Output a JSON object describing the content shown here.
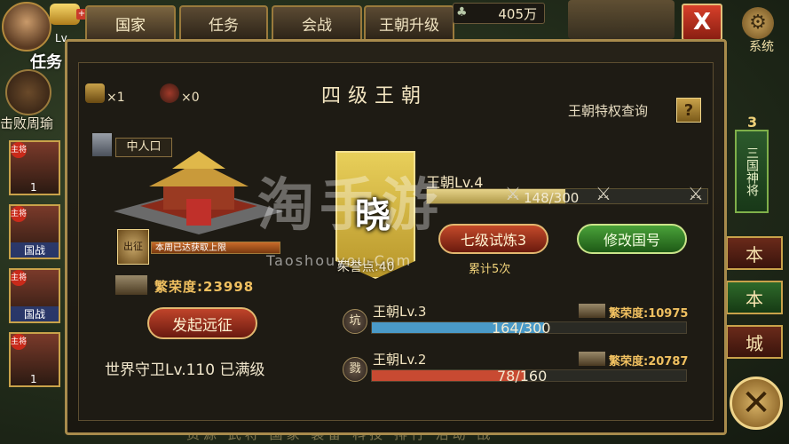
{
  "tabs": [
    {
      "label": "国家",
      "active": true
    },
    {
      "label": "任务",
      "active": false
    },
    {
      "label": "会战",
      "active": false
    },
    {
      "label": "王朝升级",
      "active": false
    }
  ],
  "top_bar": {
    "silver_amount": "405万",
    "close_label": "X",
    "system_label": "系统",
    "avatar_level_label": "Lv"
  },
  "left_strip": {
    "task_label": "任务",
    "defeat_text": "击败周瑜",
    "heroes": [
      {
        "badge": "主将",
        "foot": "1",
        "foot_style": "plain"
      },
      {
        "badge": "主将",
        "foot": "国战",
        "foot_style": "banner"
      },
      {
        "badge": "主将",
        "foot": "国战",
        "foot_style": "banner"
      },
      {
        "badge": "主将",
        "foot": "1",
        "foot_style": "plain"
      }
    ]
  },
  "right_strip": {
    "number": "3",
    "banner": "三国神将",
    "buttons": [
      "本",
      "本",
      "城"
    ]
  },
  "panel": {
    "title": "四级王朝",
    "privilege_link": "王朝特权查询",
    "help_label": "?",
    "resources": [
      {
        "icon": "seal-icon",
        "count": "×1"
      },
      {
        "icon": "gourd-icon",
        "count": "×0"
      }
    ],
    "population": "中人口",
    "capacity_seal": "出征",
    "capacity_text": "本周已达获取上限",
    "prosperity_label": "繁荣度",
    "prosperity_value": "23998",
    "expedition_button": "发起远征",
    "world_guard": "世界守卫Lv.110  已满级",
    "flag_character": "晓",
    "honor_points": "荣誉点:40",
    "dynasty_level": "王朝Lv.4",
    "progress_text": "148/300",
    "progress_fraction": 0.4933,
    "trial_button": "七级试炼3",
    "rename_button": "修改国号",
    "trial_count": "累计5次",
    "rivals": [
      {
        "icon_char": "坑",
        "level": "王朝Lv.3",
        "progress_text": "164/300",
        "progress_fraction": 0.5467,
        "color": "#4a9ac8",
        "prosperity_label": "繁荣度",
        "prosperity_value": "10975"
      },
      {
        "icon_char": "戮",
        "level": "王朝Lv.2",
        "progress_text": "78/160",
        "progress_fraction": 0.4875,
        "color": "#c84a32",
        "prosperity_label": "繁荣度",
        "prosperity_value": "20787"
      }
    ]
  },
  "watermark": {
    "text": "淘手游",
    "url": "Taoshouyou.Com"
  },
  "bottom_menu": "资源 武将 国家 装备 科技 排行 活动 战"
}
